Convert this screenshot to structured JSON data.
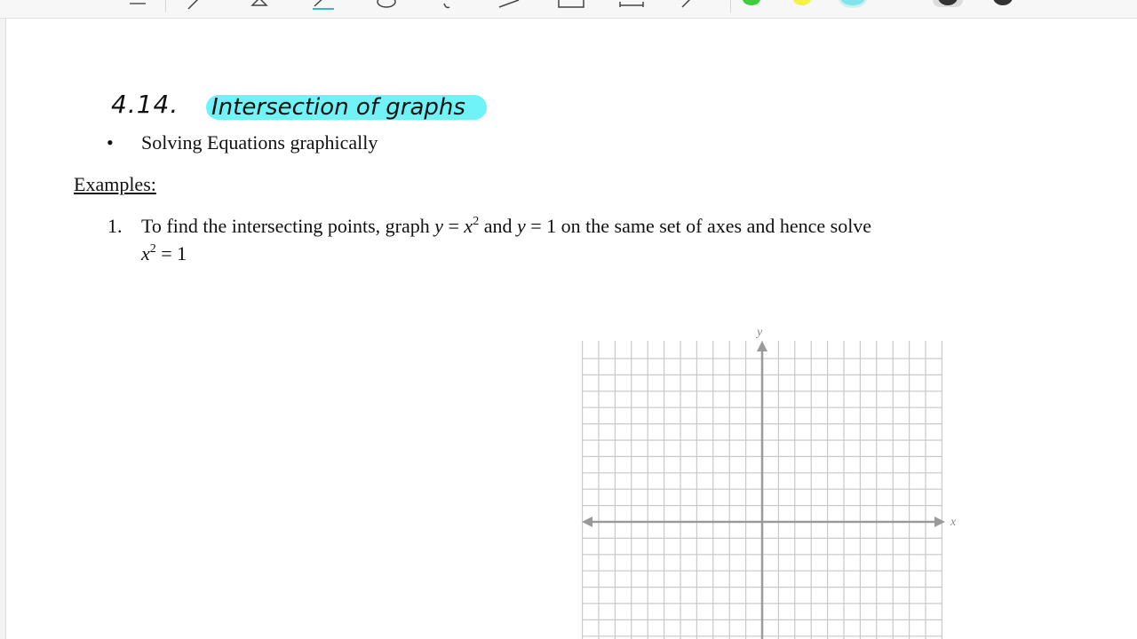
{
  "toolbar": {
    "tools": [
      "menu-icon",
      "pen-icon",
      "eraser-icon",
      "highlighter-icon",
      "lasso-icon",
      "hand-icon",
      "shapes-icon",
      "text-box-icon",
      "ruler-icon",
      "more-icon"
    ],
    "colors": [
      "#3ecf3e",
      "#f5f04a",
      "#7fe3ea"
    ],
    "active_color": "#7fe3ea"
  },
  "heading": {
    "number": "4.14.",
    "title": "Intersection of graphs",
    "highlight_color": "#6ff3f7"
  },
  "bullet": {
    "marker": "•",
    "text": "Solving Equations graphically"
  },
  "examples_label": "Examples:",
  "question": {
    "number": "1.",
    "line1_a": "To find the intersecting points, graph ",
    "eq1_lhs": "y",
    "eq1_eq": " = ",
    "eq1_base": "x",
    "eq1_exp": "2",
    "line1_b": " and ",
    "eq2_lhs": "y",
    "eq2_rhs": " = 1",
    "line1_c": " on the same set of axes and hence solve",
    "eq3_base": "x",
    "eq3_exp": "2",
    "eq3_rhs": " = 1"
  },
  "chart_data": {
    "type": "scatter",
    "x_axis_label": "x",
    "y_axis_label": "y",
    "grid": true,
    "series": []
  }
}
